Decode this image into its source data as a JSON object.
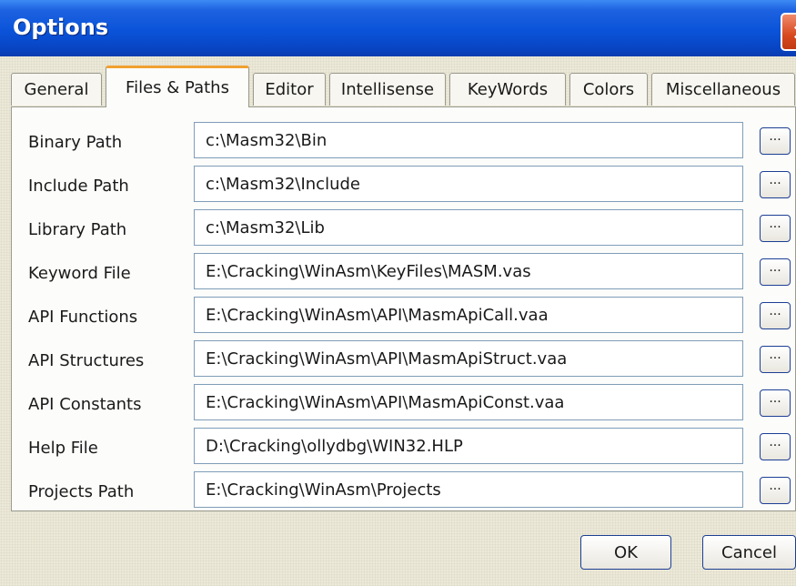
{
  "window": {
    "title": "Options",
    "close_symbol": "×"
  },
  "tabs": [
    {
      "label": "General"
    },
    {
      "label": "Files & Paths",
      "active": true
    },
    {
      "label": "Editor"
    },
    {
      "label": "Intellisense"
    },
    {
      "label": "KeyWords"
    },
    {
      "label": "Colors"
    },
    {
      "label": "Miscellaneous"
    }
  ],
  "rows": [
    {
      "label": "Binary Path",
      "value": "c:\\Masm32\\Bin"
    },
    {
      "label": "Include Path",
      "value": "c:\\Masm32\\Include"
    },
    {
      "label": "Library Path",
      "value": "c:\\Masm32\\Lib"
    },
    {
      "label": "Keyword File",
      "value": "E:\\Cracking\\WinAsm\\KeyFiles\\MASM.vas"
    },
    {
      "label": "API Functions",
      "value": "E:\\Cracking\\WinAsm\\API\\MasmApiCall.vaa"
    },
    {
      "label": "API Structures",
      "value": "E:\\Cracking\\WinAsm\\API\\MasmApiStruct.vaa"
    },
    {
      "label": "API Constants",
      "value": "E:\\Cracking\\WinAsm\\API\\MasmApiConst.vaa"
    },
    {
      "label": "Help File",
      "value": "D:\\Cracking\\ollydbg\\WIN32.HLP"
    },
    {
      "label": "Projects Path",
      "value": "E:\\Cracking\\WinAsm\\Projects"
    }
  ],
  "browse_label": "...",
  "footer": {
    "ok_label": "OK",
    "cancel_label": "Cancel"
  },
  "colors": {
    "titlebar": "#0a53d9",
    "close": "#d8491f",
    "active_tab_accent": "#f0a030"
  }
}
